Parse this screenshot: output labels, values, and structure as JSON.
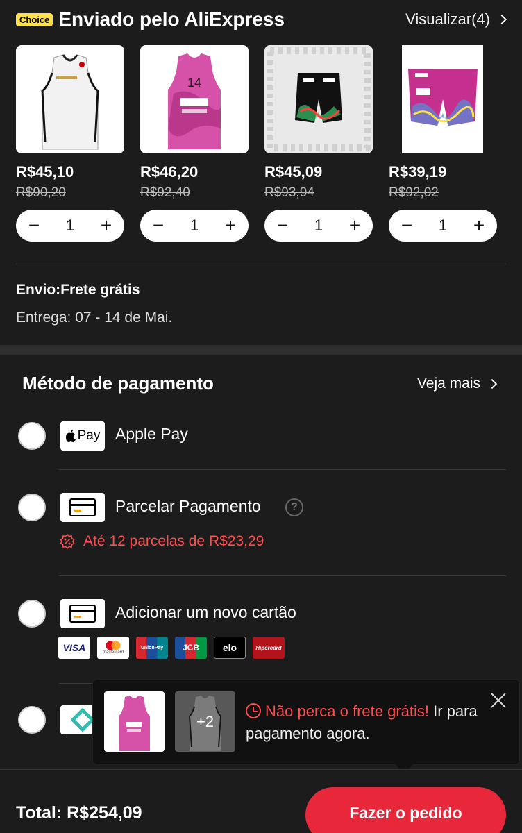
{
  "header": {
    "badge": "Choice",
    "title": "Enviado pelo AliExpress",
    "view_all": "Visualizar(4)"
  },
  "products": [
    {
      "price": "R$45,10",
      "old_price": "R$90,20",
      "qty": "1"
    },
    {
      "price": "R$46,20",
      "old_price": "R$92,40",
      "qty": "1"
    },
    {
      "price": "R$45,09",
      "old_price": "R$93,94",
      "qty": "1"
    },
    {
      "price": "R$39,19",
      "old_price": "R$92,02",
      "qty": "1"
    }
  ],
  "stepper": {
    "minus": "−",
    "plus": "+"
  },
  "shipping": {
    "label": "Envio:Frete grátis",
    "delivery": "Entrega: 07 - 14 de Mai."
  },
  "payment": {
    "title": "Método de pagamento",
    "see_more": "Veja mais",
    "methods": [
      {
        "label": "Apple Pay",
        "logo_text": "Pay"
      },
      {
        "label": "Parcelar Pagamento",
        "note": "Até 12 parcelas de R$23,29"
      },
      {
        "label": "Adicionar um novo cartão"
      }
    ],
    "brands": [
      "VISA",
      "mastercard",
      "UnionPay",
      "JCB",
      "elo",
      "Hipercard"
    ]
  },
  "toast": {
    "plus_more": "+2",
    "highlight": "Não perca o frete grátis!",
    "rest": " Ir para pagamento agora."
  },
  "footer": {
    "total": "Total: R$254,09",
    "order_button": "Fazer o pedido"
  },
  "colors": {
    "accent": "#e8283a",
    "alert": "#ff4d4f",
    "choice_badge": "#fce14b"
  }
}
